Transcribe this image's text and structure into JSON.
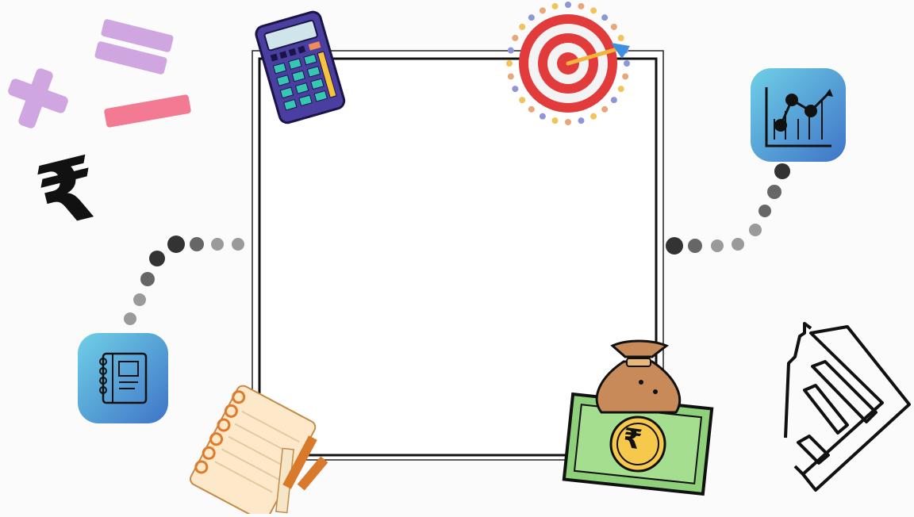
{
  "scene": {
    "background": "#fbfbfb",
    "currency_symbol": "₹",
    "icons": [
      "plus-icon",
      "equals-icon",
      "minus-icon",
      "rupee-icon",
      "calculator-icon",
      "target-icon",
      "growth-chart-icon",
      "notebook-icon",
      "notepad-pencil-icon",
      "money-bag-icon",
      "banknote-icon",
      "bar-chart-arrow-icon"
    ],
    "colors": {
      "math_purple": "#cfa6e0",
      "math_pink": "#f27a93",
      "calculator_body": "#4a3fa0",
      "target_red": "#e23b3b",
      "app_tile_start": "#6fd0e6",
      "app_tile_end": "#3f74c8",
      "banknote_green": "#8ed17a",
      "coin_yellow": "#f6c94c",
      "bag_brown": "#c98a5a",
      "notepad_paper": "#fde9c9",
      "dots_dark": "#333333",
      "dots_light": "#9a9a9a"
    }
  }
}
